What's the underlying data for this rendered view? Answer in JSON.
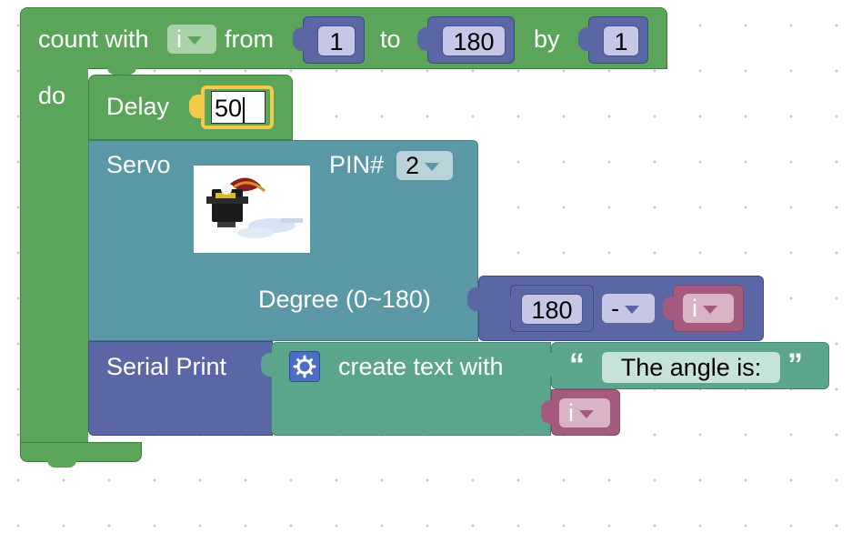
{
  "loop_block": {
    "label_count": "count with",
    "var": "i",
    "label_from": "from",
    "from_value": "1",
    "label_to": "to",
    "to_value": "180",
    "label_by": "by",
    "by_value": "1",
    "label_do": "do",
    "color": "#5ba55b"
  },
  "delay_block": {
    "label": "Delay",
    "value": "50",
    "color": "#5ba55b",
    "highlight": "#f7c948"
  },
  "servo_block": {
    "label": "Servo",
    "pin_label": "PIN#",
    "pin_value": "2",
    "degree_label": "Degree (0~180)",
    "image_icon": "servo-motor-image",
    "color": "#5b98a5"
  },
  "math_block": {
    "value": "180",
    "operator": "-",
    "var": "i",
    "color": "#5b67a5"
  },
  "serial_block": {
    "label": "Serial Print",
    "color": "#5b67a5"
  },
  "text_join_block": {
    "gear_icon": "gear-icon",
    "label": "create text with",
    "quote_open": "“",
    "text": "The angle is:",
    "quote_close": "”",
    "var": "i",
    "color": "#5ba58c"
  }
}
